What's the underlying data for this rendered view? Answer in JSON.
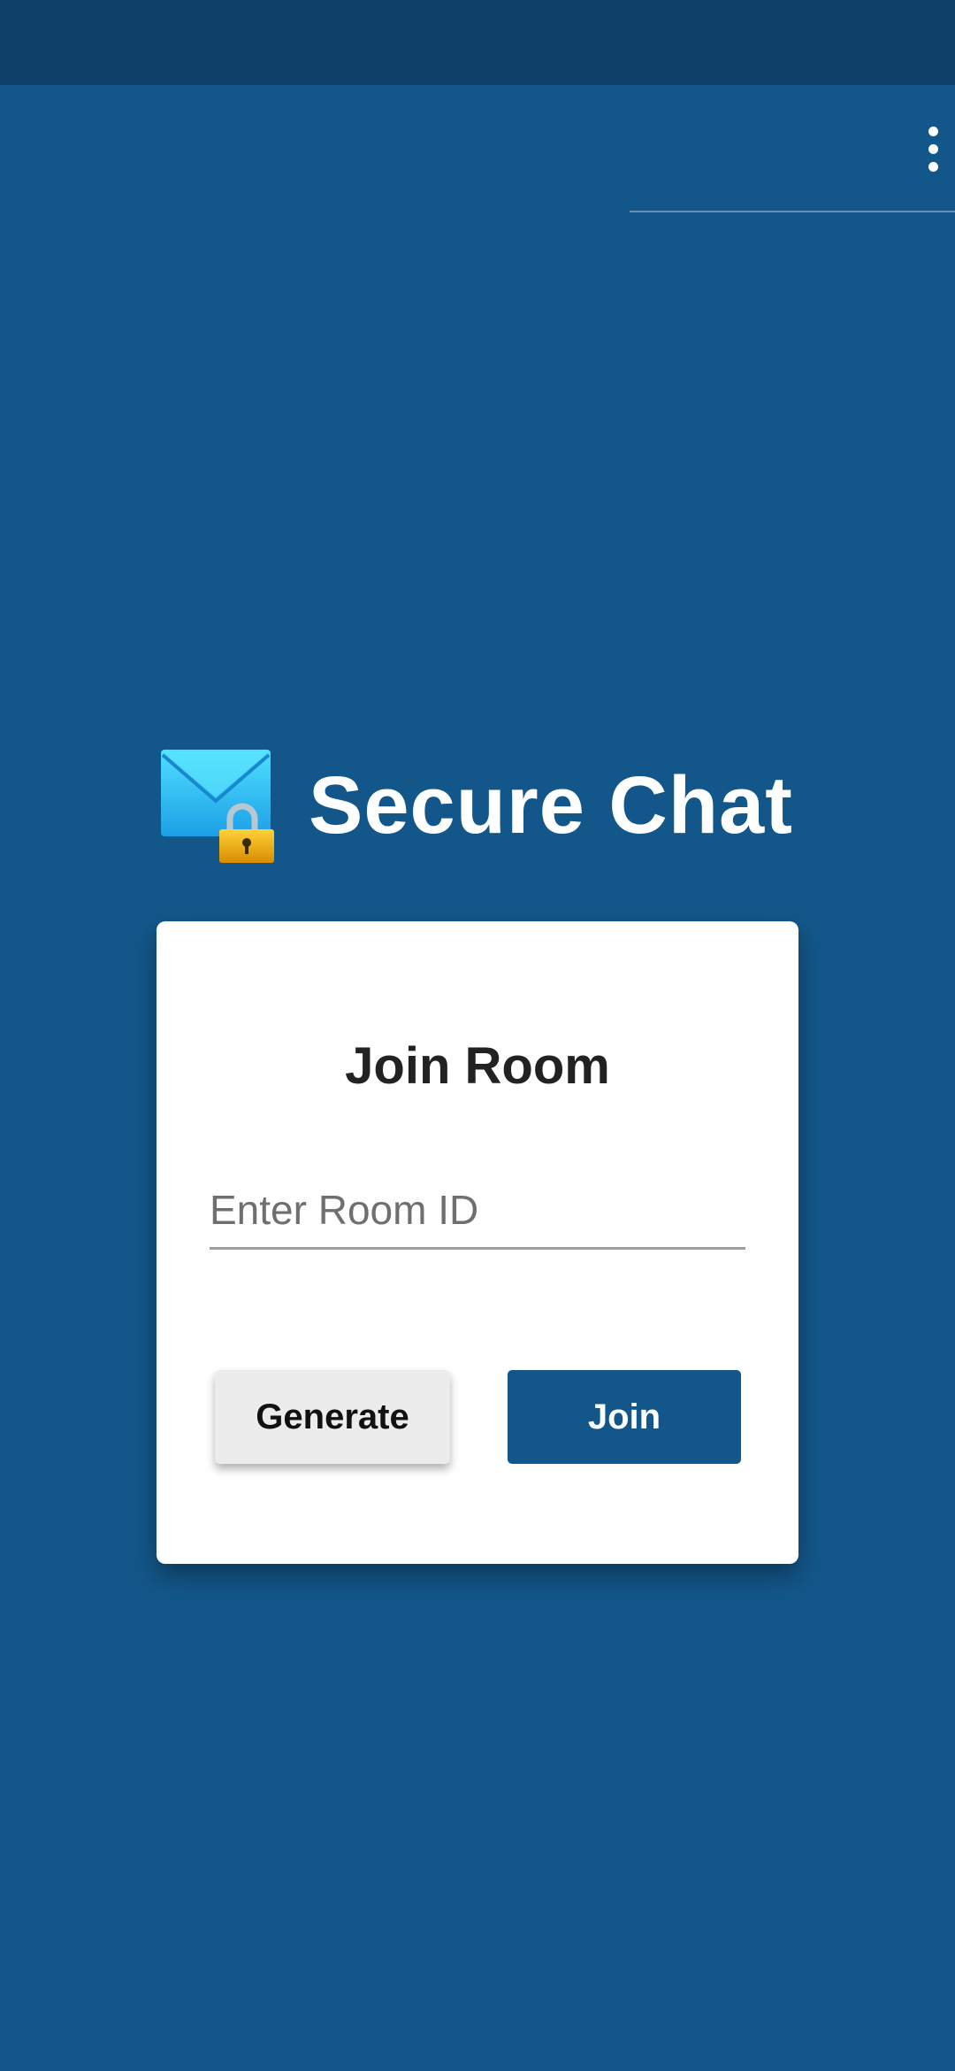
{
  "app": {
    "title": "Secure Chat",
    "icon": "envelope-with-lock-icon"
  },
  "toolbar": {
    "overflow_icon": "more-vertical-icon"
  },
  "join_card": {
    "title": "Join Room",
    "room_input": {
      "placeholder": "Enter Room ID",
      "value": ""
    },
    "generate_label": "Generate",
    "join_label": "Join"
  },
  "colors": {
    "background": "#13578a",
    "status_bar": "#0e406a",
    "card": "#ffffff",
    "join_button": "#13578a",
    "generate_button": "#ececec"
  }
}
